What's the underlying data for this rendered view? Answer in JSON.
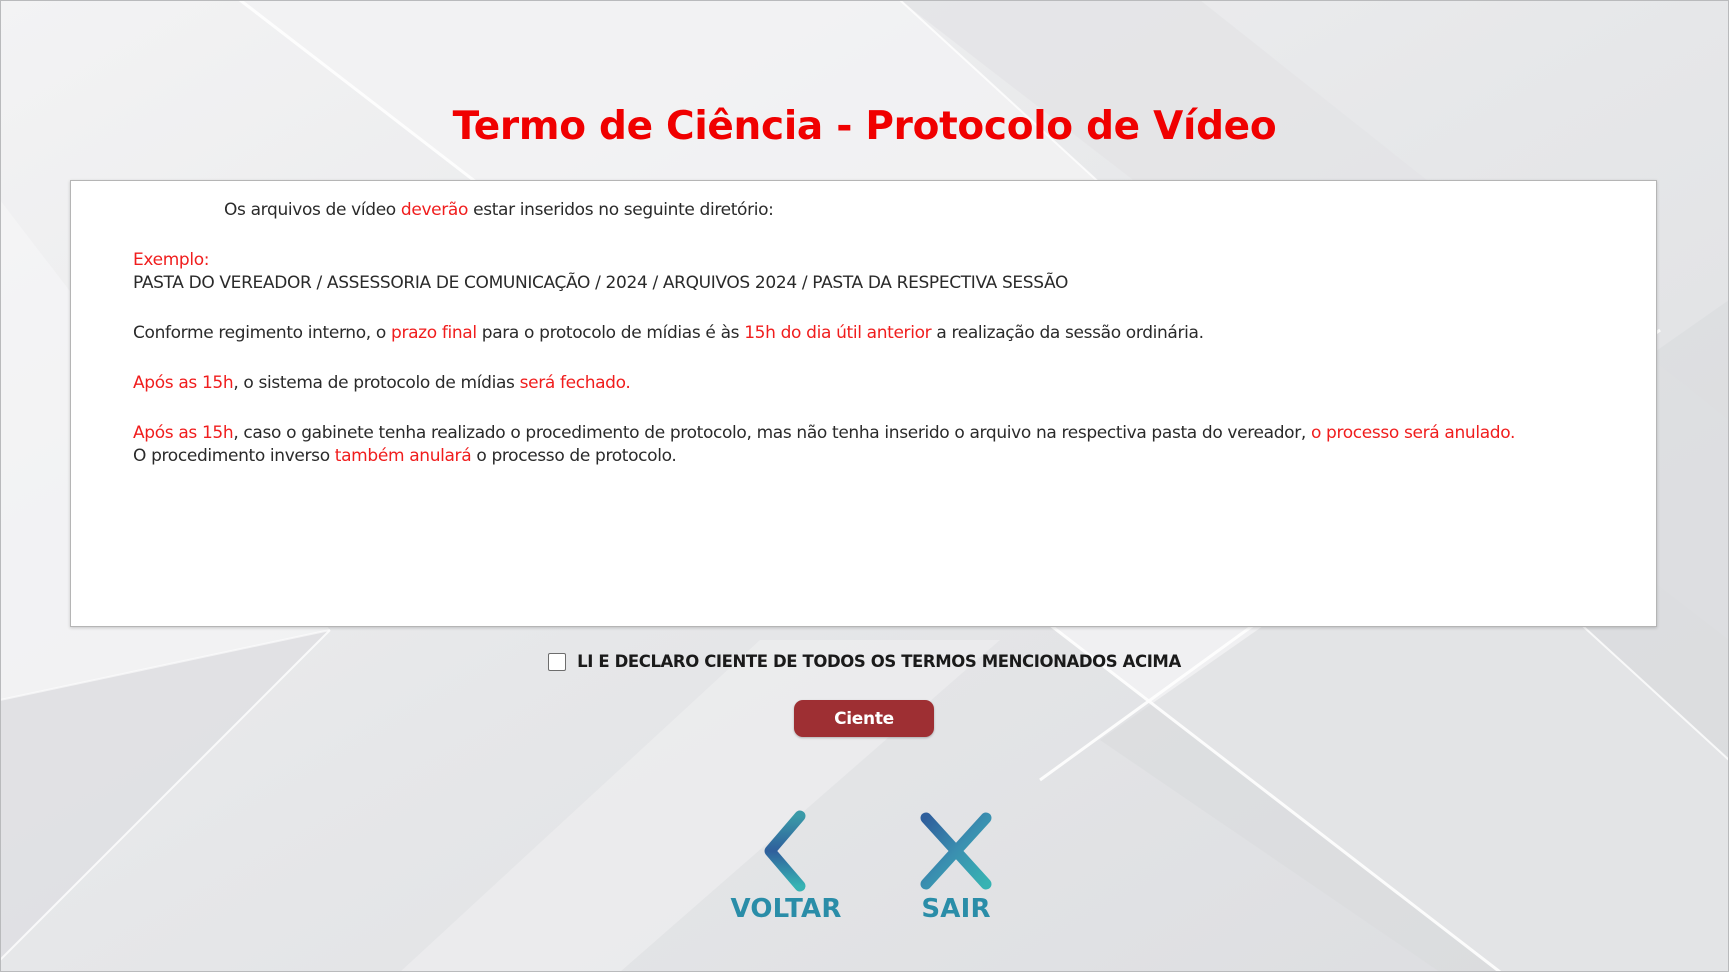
{
  "page": {
    "title": "Termo de Ciência - Protocolo de Vídeo"
  },
  "terms": {
    "intro": {
      "t1": "Os arquivos de vídeo ",
      "t2": "deverão",
      "t3": " estar inseridos no seguinte diretório:"
    },
    "example": {
      "label": "Exemplo:",
      "path": "PASTA DO VEREADOR / ASSESSORIA DE COMUNICAÇÃO / 2024 / ARQUIVOS 2024 / PASTA DA RESPECTIVA SESSÃO"
    },
    "deadline": {
      "t1": "Conforme regimento interno, o ",
      "t2": "prazo final",
      "t3": " para o protocolo de mídias é às ",
      "t4": "15h do dia útil anterior",
      "t5": " a realização da sessão ordinária."
    },
    "closing": {
      "t1": "Após as 15h",
      "t2": ", o sistema de protocolo de mídias ",
      "t3": "será fechado."
    },
    "annul": {
      "t1": "Após as 15h",
      "t2": ", caso o gabinete tenha realizado o procedimento de protocolo, mas não tenha inserido o arquivo na respectiva pasta do vereador, ",
      "t3": "o processo será anulado.",
      "t4": "O procedimento inverso ",
      "t5": "também anulará",
      "t6": " o processo de protocolo."
    }
  },
  "agree": {
    "label": "LI E DECLARO CIENTE DE TODOS OS TERMOS MENCIONADOS ACIMA",
    "checked": false
  },
  "buttons": {
    "ciente": "Ciente",
    "voltar": "VOLTAR",
    "sair": "SAIR"
  },
  "icons": {
    "voltar": "chevron-left-icon",
    "sair": "close-icon"
  },
  "colors": {
    "title": "#f00000",
    "highlight": "#f01d1d",
    "ciente_button": "#9e2f33",
    "nav_label": "#2a8da8"
  }
}
